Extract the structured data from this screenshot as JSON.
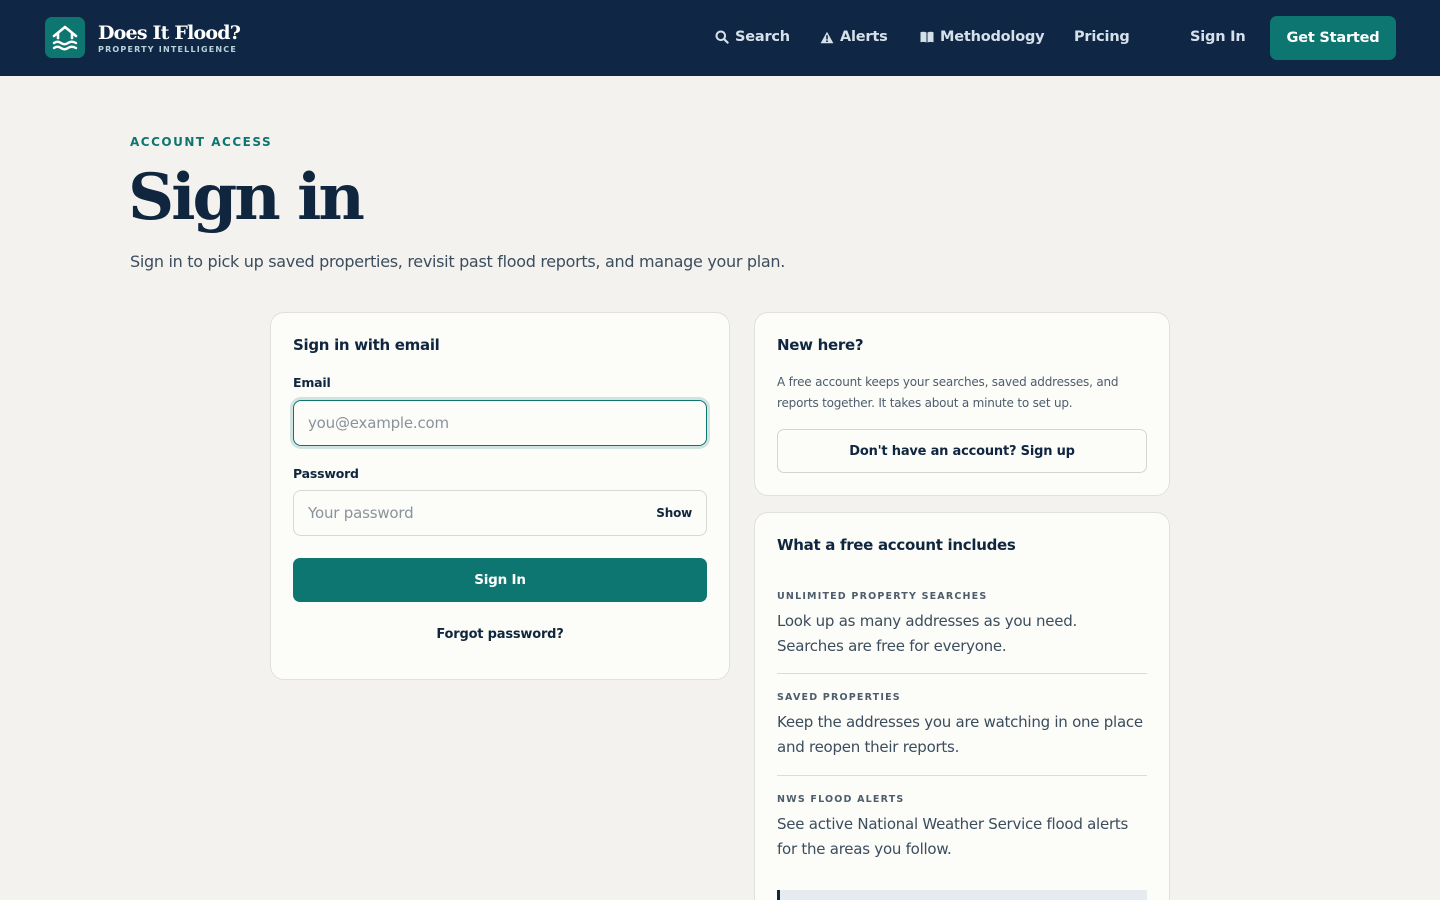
{
  "header": {
    "brand_name": "Does It Flood?",
    "brand_tagline": "PROPERTY INTELLIGENCE",
    "nav": [
      {
        "label": "Search",
        "icon": "search-icon"
      },
      {
        "label": "Alerts",
        "icon": "warning-icon"
      },
      {
        "label": "Methodology",
        "icon": "book-icon"
      },
      {
        "label": "Pricing",
        "icon": ""
      }
    ],
    "sign_in_label": "Sign In",
    "cta_label": "Get Started"
  },
  "hero": {
    "eyebrow": "ACCOUNT ACCESS",
    "title": "Sign in",
    "lead": "Sign in to pick up saved properties, revisit past flood reports, and manage your plan."
  },
  "signin_card": {
    "title": "Sign in with email",
    "email_label": "Email",
    "email_placeholder": "you@example.com",
    "password_label": "Password",
    "password_placeholder": "Your password",
    "show_label": "Show",
    "submit_label": "Sign In",
    "forgot_label": "Forgot password?"
  },
  "new_card": {
    "title": "New here?",
    "body": "A free account keeps your searches, saved addresses, and reports together. It takes about a minute to set up.",
    "signup_label": "Don't have an account? Sign up"
  },
  "features_card": {
    "title": "What a free account includes",
    "items": [
      {
        "heading": "UNLIMITED PROPERTY SEARCHES",
        "body": "Look up as many addresses as you need. Searches are free for everyone."
      },
      {
        "heading": "SAVED PROPERTIES",
        "body": "Keep the addresses you are watching in one place and reopen their reports."
      },
      {
        "heading": "NWS FLOOD ALERTS",
        "body": "See active National Weather Service flood alerts for the areas you follow."
      }
    ]
  },
  "colors": {
    "navy": "#0f2744",
    "teal": "#0e7670",
    "page_bg": "#f3f2ee",
    "card_bg": "#fcfcf9"
  }
}
